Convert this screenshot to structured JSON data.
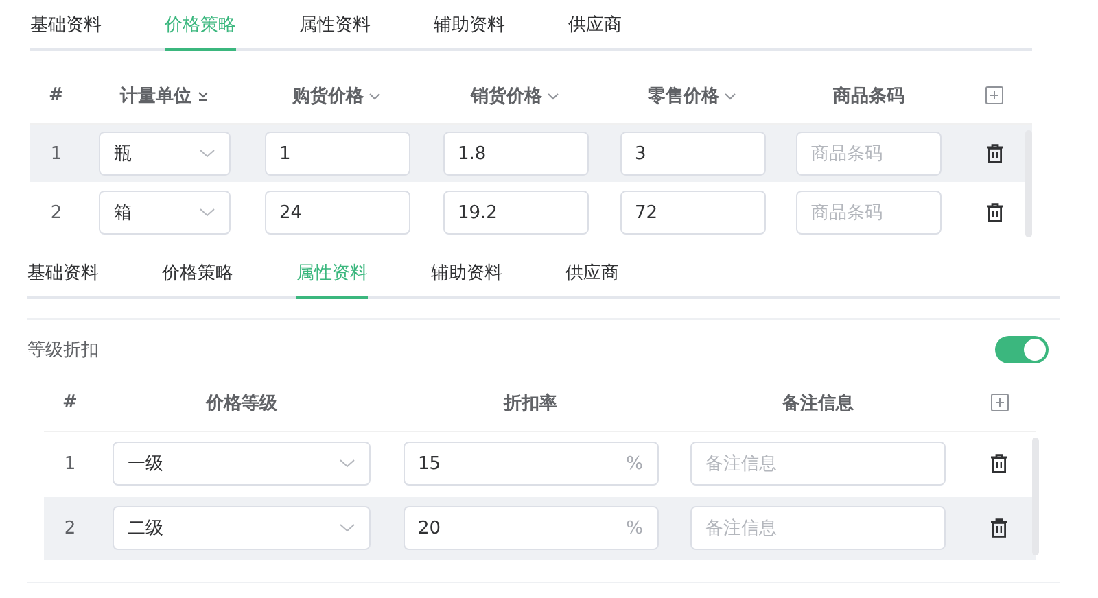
{
  "price_panel": {
    "tabs": [
      {
        "label": "基础资料",
        "selected": false
      },
      {
        "label": "价格策略",
        "selected": true
      },
      {
        "label": "属性资料",
        "selected": false
      },
      {
        "label": "辅助资料",
        "selected": false
      },
      {
        "label": "供应商",
        "selected": false
      }
    ],
    "columns": [
      {
        "label": "#",
        "kind": "plain"
      },
      {
        "label": "计量单位",
        "kind": "sort"
      },
      {
        "label": "购货价格",
        "kind": "dropdown"
      },
      {
        "label": "销货价格",
        "kind": "dropdown"
      },
      {
        "label": "零售价格",
        "kind": "dropdown"
      },
      {
        "label": "商品条码",
        "kind": "plain"
      },
      {
        "kind": "add"
      }
    ],
    "rows": [
      {
        "number": "1",
        "unit": "瓶",
        "purchase_price": "1",
        "sale_price": "1.8",
        "retail_price": "3",
        "barcode_placeholder": "商品条码",
        "highlighted": true
      },
      {
        "number": "2",
        "unit": "箱",
        "purchase_price": "24",
        "sale_price": "19.2",
        "retail_price": "72",
        "barcode_placeholder": "商品条码",
        "highlighted": false
      }
    ]
  },
  "attribute_panel": {
    "tabs": [
      {
        "label": "基础资料",
        "selected": false
      },
      {
        "label": "价格策略",
        "selected": false
      },
      {
        "label": "属性资料",
        "selected": true
      },
      {
        "label": "辅助资料",
        "selected": false
      },
      {
        "label": "供应商",
        "selected": false
      }
    ],
    "discount": {
      "label": "等级折扣",
      "on": true
    },
    "columns": [
      {
        "label": "#",
        "kind": "plain"
      },
      {
        "label": "价格等级",
        "kind": "plain"
      },
      {
        "label": "折扣率",
        "kind": "plain"
      },
      {
        "label": "备注信息",
        "kind": "plain"
      },
      {
        "kind": "add"
      }
    ],
    "rows": [
      {
        "number": "1",
        "level": "一级",
        "rate": "15",
        "rate_suffix": "%",
        "remark_placeholder": "备注信息",
        "highlighted": false
      },
      {
        "number": "2",
        "level": "二级",
        "rate": "20",
        "rate_suffix": "%",
        "remark_placeholder": "备注信息",
        "highlighted": true
      }
    ]
  }
}
